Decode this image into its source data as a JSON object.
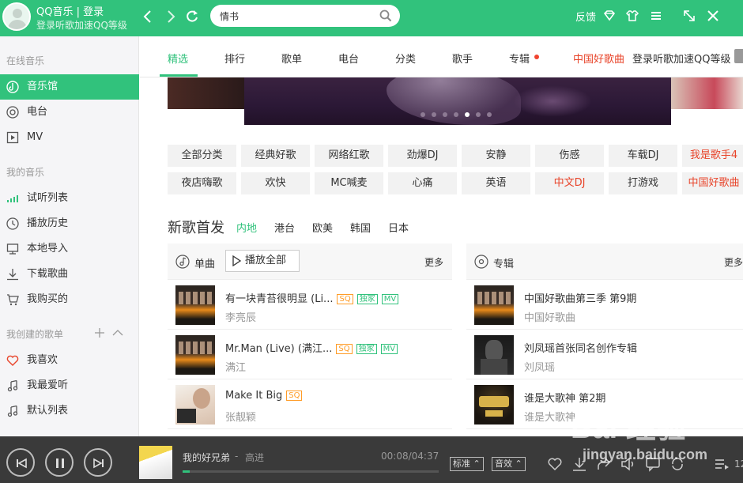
{
  "app": {
    "name_line": "QQ音乐 | 登录",
    "login_hint": "登录听歌加速QQ等级"
  },
  "topbar": {
    "search_value": "情书",
    "feedback": "反馈",
    "icons": [
      "back-icon",
      "forward-icon",
      "refresh-icon",
      "search-icon",
      "diamond-icon",
      "shirt-icon",
      "menu-icon",
      "minimize-icon",
      "close-icon"
    ]
  },
  "sidebar": {
    "online_title": "在线音乐",
    "online_items": [
      {
        "label": "音乐馆",
        "icon": "music-hall-icon"
      },
      {
        "label": "电台",
        "icon": "radio-icon"
      },
      {
        "label": "MV",
        "icon": "mv-icon"
      }
    ],
    "mine_title": "我的音乐",
    "mine_items": [
      {
        "label": "试听列表",
        "icon": "equalizer-icon"
      },
      {
        "label": "播放历史",
        "icon": "clock-icon"
      },
      {
        "label": "本地导入",
        "icon": "monitor-icon"
      },
      {
        "label": "下载歌曲",
        "icon": "download-icon"
      },
      {
        "label": "我购买的",
        "icon": "cart-icon"
      }
    ],
    "created_title": "我创建的歌单",
    "created_items": [
      {
        "label": "我喜欢",
        "icon": "heart-icon"
      },
      {
        "label": "我最爱听",
        "icon": "note-icon"
      },
      {
        "label": "默认列表",
        "icon": "note-icon"
      }
    ]
  },
  "tabs": {
    "items": [
      "精选",
      "排行",
      "歌单",
      "电台",
      "分类",
      "歌手",
      "专辑"
    ],
    "active": "精选",
    "promo": "中国好歌曲",
    "login": "登录听歌加速QQ等级"
  },
  "banner": {
    "dot_count": 7,
    "active_dot": 4
  },
  "tags": {
    "row1": [
      "全部分类",
      "经典好歌",
      "网络红歌",
      "劲爆DJ",
      "安静",
      "伤感",
      "车载DJ",
      "我是歌手4"
    ],
    "row2": [
      "夜店嗨歌",
      "欢快",
      "MC喊麦",
      "心痛",
      "英语",
      "中文DJ",
      "打游戏",
      "中国好歌曲"
    ],
    "red_tags": [
      "我是歌手4",
      "中文DJ",
      "中国好歌曲"
    ]
  },
  "new_songs": {
    "title": "新歌首发",
    "regions": [
      "内地",
      "港台",
      "欧美",
      "韩国",
      "日本"
    ],
    "active_region": "内地"
  },
  "singles": {
    "header": "单曲",
    "play_all": "播放全部",
    "more": "更多",
    "rows": [
      {
        "title": "有一块青苔很明显 (Li...",
        "artist": "李亮辰",
        "badges": [
          "SQ",
          "独家",
          "MV"
        ]
      },
      {
        "title": "Mr.Man (Live) (满江...",
        "artist": "满江",
        "badges": [
          "SQ",
          "独家",
          "MV"
        ]
      },
      {
        "title": "Make It Big",
        "artist": "张靓颖",
        "badges": [
          "SQ"
        ]
      }
    ]
  },
  "albums": {
    "header": "专辑",
    "more": "更多",
    "rows": [
      {
        "title": "中国好歌曲第三季 第9期",
        "artist": "中国好歌曲"
      },
      {
        "title": "刘凤瑶首张同名创作专辑",
        "artist": "刘凤瑶"
      },
      {
        "title": "谁是大歌神 第2期",
        "artist": "谁是大歌神"
      }
    ]
  },
  "player": {
    "song": "我的好兄弟",
    "separator": "-",
    "artist": "高进",
    "time": "00:08/04:37",
    "progress": 0.029,
    "quality": "标准",
    "effect": "音效",
    "count": "12"
  },
  "watermark": {
    "brand": "Bai 经验",
    "url": "jingyan.baidu.com"
  },
  "colors": {
    "accent": "#31c27c",
    "promo_red": "#e8442a",
    "player_bg": "#3a3a3a",
    "sq_badge": "#ff9c27"
  }
}
